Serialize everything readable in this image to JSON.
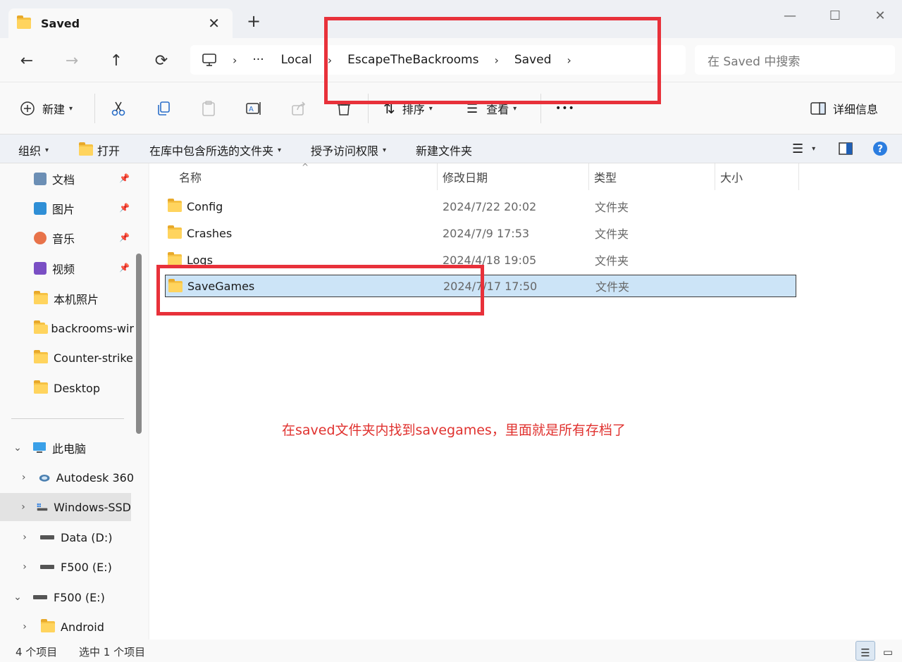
{
  "tab": {
    "title": "Saved",
    "close": "✕",
    "new_tab": "+"
  },
  "window": {
    "minimize": "—",
    "maximize": "☐",
    "close": "✕"
  },
  "nav": {
    "back": "←",
    "forward": "→",
    "up": "↑",
    "refresh": "⟳"
  },
  "address": {
    "ellipsis": "···",
    "crumbs": [
      "Local",
      "EscapeTheBackrooms",
      "Saved"
    ],
    "sep": "›"
  },
  "search": {
    "placeholder": "在 Saved 中搜索"
  },
  "commands": {
    "new_label": "新建",
    "sort_label": "排序",
    "view_label": "查看",
    "more": "•••",
    "details_label": "详细信息"
  },
  "ribbon": {
    "organize": "组织",
    "open": "打开",
    "include_library": "在库中包含所选的文件夹",
    "grant_access": "授予访问权限",
    "new_folder": "新建文件夹"
  },
  "sidebar": {
    "items": [
      {
        "label": "文档",
        "icon": "document-icon"
      },
      {
        "label": "图片",
        "icon": "pictures-icon"
      },
      {
        "label": "音乐",
        "icon": "music-icon"
      },
      {
        "label": "视频",
        "icon": "video-icon"
      },
      {
        "label": "本机照片",
        "icon": "folder-icon"
      },
      {
        "label": "backrooms-wir",
        "icon": "folder-icon"
      },
      {
        "label": "Counter-strike",
        "icon": "folder-icon"
      },
      {
        "label": "Desktop",
        "icon": "folder-icon"
      }
    ],
    "tree": [
      {
        "label": "此电脑",
        "icon": "pc-icon"
      },
      {
        "label": "Autodesk 360",
        "icon": "cloud-icon"
      },
      {
        "label": "Windows-SSD",
        "icon": "drive-icon"
      },
      {
        "label": "Data (D:)",
        "icon": "drive-icon"
      },
      {
        "label": "F500 (E:)",
        "icon": "drive-icon"
      },
      {
        "label": "F500 (E:)",
        "icon": "drive-icon"
      },
      {
        "label": "Android",
        "icon": "folder-icon"
      }
    ]
  },
  "columns": {
    "name": "名称",
    "date": "修改日期",
    "type": "类型",
    "size": "大小"
  },
  "files": [
    {
      "name": "Config",
      "date": "2024/7/22 20:02",
      "type": "文件夹"
    },
    {
      "name": "Crashes",
      "date": "2024/7/9 17:53",
      "type": "文件夹"
    },
    {
      "name": "Logs",
      "date": "2024/4/18 19:05",
      "type": "文件夹"
    },
    {
      "name": "SaveGames",
      "date": "2024/7/17 17:50",
      "type": "文件夹"
    }
  ],
  "annotation": "在saved文件夹内找到savegames，里面就是所有存档了",
  "status": {
    "count": "4 个项目",
    "selected": "选中 1 个项目"
  },
  "colors": {
    "annotation_red": "#e8313a",
    "selection": "#cce4f7",
    "accent": "#2b6fc9"
  }
}
